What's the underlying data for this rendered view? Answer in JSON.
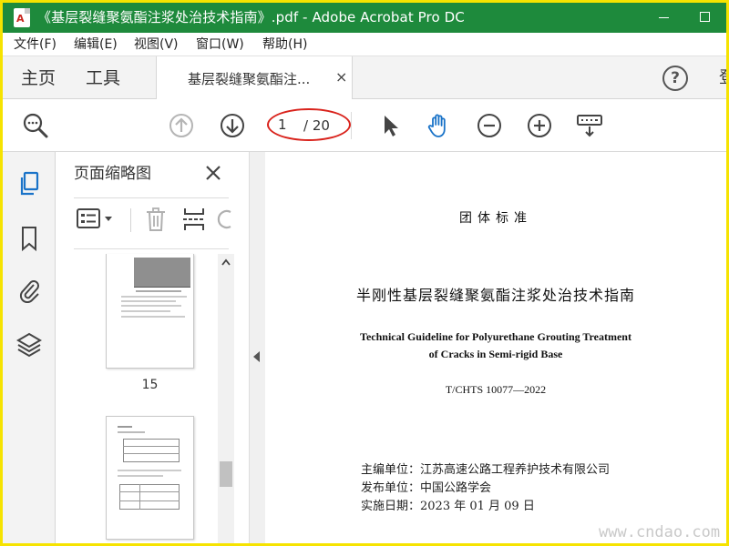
{
  "window": {
    "title": "《基层裂缝聚氨酯注浆处治技术指南》.pdf - Adobe Acrobat Pro DC",
    "minimize_label": "",
    "maximize_label": ""
  },
  "menu": [
    "文件(F)",
    "编辑(E)",
    "视图(V)",
    "窗口(W)",
    "帮助(H)"
  ],
  "tabs": {
    "home": "主页",
    "tools": "工具",
    "document": "基层裂缝聚氨酯注...",
    "close": "×",
    "help": "?",
    "cut_off": "登"
  },
  "toolbar": {
    "current_page": "1",
    "page_total": "/ 20"
  },
  "thumbnails": {
    "title": "页面缩略图",
    "pages": [
      {
        "label": "15"
      },
      {
        "label": ""
      }
    ]
  },
  "document": {
    "standard": "团体标准",
    "title_cn": "半刚性基层裂缝聚氨酯注浆处治技术指南",
    "title_en_line1": "Technical Guideline for Polyurethane Grouting Treatment",
    "title_en_line2": "of Cracks in Semi-rigid Base",
    "code": "T/CHTS  10077—2022",
    "editor": "主编单位：江苏高速公路工程养护技术有限公司",
    "publisher": "发布单位：中国公路学会",
    "date": "实施日期：2023 年 01 月 09 日"
  },
  "watermark": "www.cndao.com",
  "colors": {
    "titlebar": "#1e8a3c",
    "accent_blue": "#1a73c8",
    "highlight_red": "#d9231c",
    "border_yellow": "#f6e300"
  },
  "icons": [
    "pdf-file-icon",
    "minimize-icon",
    "maximize-icon",
    "help-icon",
    "zoom-search-icon",
    "previous-page-icon",
    "next-page-icon",
    "select-pointer-icon",
    "hand-tool-icon",
    "zoom-out-icon",
    "zoom-in-icon",
    "keyboard-scroll-icon",
    "thumbnails-icon",
    "bookmark-icon",
    "attachment-icon",
    "layers-icon",
    "options-list-icon",
    "delete-icon",
    "insert-page-icon",
    "rotate-icon",
    "close-icon",
    "scroll-up-icon",
    "collapse-arrow-icon"
  ]
}
